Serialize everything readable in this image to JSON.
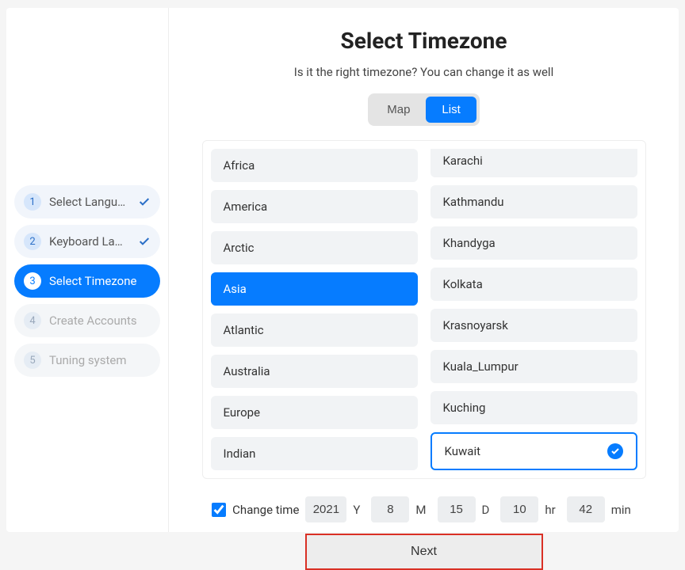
{
  "sidebar": {
    "steps": [
      {
        "num": "1",
        "label": "Select Langu…",
        "state": "done",
        "check": true
      },
      {
        "num": "2",
        "label": "Keyboard La…",
        "state": "done",
        "check": true
      },
      {
        "num": "3",
        "label": "Select Timezone",
        "state": "active",
        "check": false
      },
      {
        "num": "4",
        "label": "Create Accounts",
        "state": "pending",
        "check": false
      },
      {
        "num": "5",
        "label": "Tuning system",
        "state": "pending",
        "check": false
      }
    ]
  },
  "header": {
    "title": "Select Timezone",
    "subtitle": "Is it the right timezone? You can change it as well"
  },
  "toggle": {
    "map": "Map",
    "list": "List",
    "active": "list"
  },
  "continents": [
    "Africa",
    "America",
    "Arctic",
    "Asia",
    "Atlantic",
    "Australia",
    "Europe",
    "Indian"
  ],
  "selected_continent": "Asia",
  "cities": [
    "Karachi",
    "Kathmandu",
    "Khandyga",
    "Kolkata",
    "Krasnoyarsk",
    "Kuala_Lumpur",
    "Kuching",
    "Kuwait"
  ],
  "selected_city": "Kuwait",
  "time": {
    "change_label": "Change time",
    "checked": true,
    "year": {
      "value": "2021",
      "unit": "Y"
    },
    "month": {
      "value": "8",
      "unit": "M"
    },
    "day": {
      "value": "15",
      "unit": "D"
    },
    "hour": {
      "value": "10",
      "unit": "hr"
    },
    "min": {
      "value": "42",
      "unit": "min"
    }
  },
  "next_label": "Next"
}
